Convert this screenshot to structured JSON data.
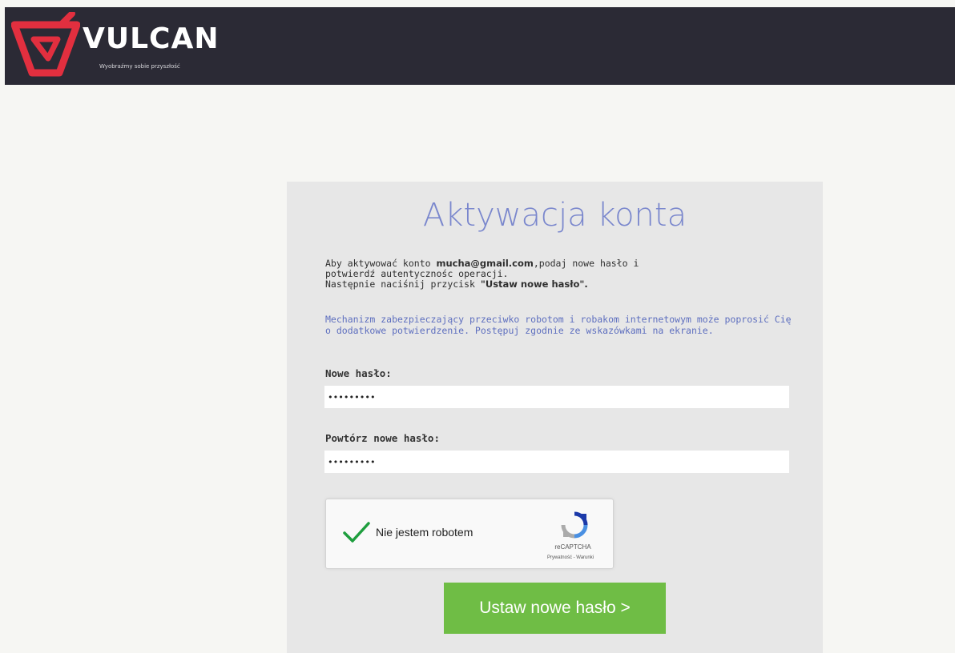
{
  "header": {
    "brand": "VULCAN",
    "tagline": "Wyobraźmy sobie przyszłość",
    "logo_icon": "vulcan-logo-icon",
    "background_color": "#2b2a35",
    "logo_color": "#e22f3f"
  },
  "activation": {
    "title": "Aktywacja konta",
    "intro_prefix": "Aby aktywować konto ",
    "email": "mucha@gmail.com",
    "intro_suffix": ",podaj nowe hasło i",
    "intro_line2": "potwierdź autentycznośc operacji.",
    "intro_line3_prefix": "Następnie naciśnij przycisk ",
    "intro_line3_button": "\"Ustaw nowe hasło\".",
    "captcha_note": "Mechanizm zabezpieczający przeciwko robotom i robakom internetowym może poprosić Cię o dodatkowe potwierdzenie. Postępuj zgodnie ze wskazówkami na ekranie.",
    "new_password_label": "Nowe hasło:",
    "new_password_value": "•••••••••",
    "repeat_password_label": "Powtórz nowe hasło:",
    "repeat_password_value": "•••••••••",
    "submit_label": "Ustaw nowe hasło >",
    "title_color": "#7a87cd",
    "submit_color": "#6fbd45"
  },
  "recaptcha": {
    "label": "Nie jestem robotem",
    "checked": true,
    "brand": "reCAPTCHA",
    "links": "Prywatność - Warunki",
    "check_icon": "checkmark-icon",
    "logo_icon": "recaptcha-logo-icon"
  }
}
